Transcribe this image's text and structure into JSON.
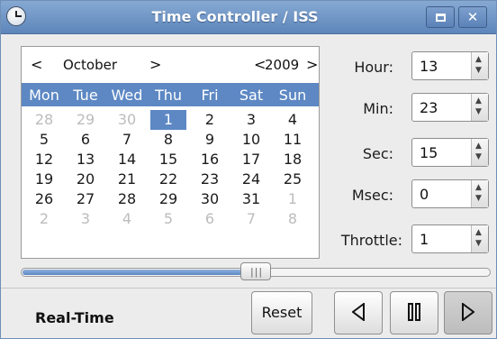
{
  "window": {
    "title": "Time Controller / ISS",
    "icon": "clock-icon"
  },
  "calendar": {
    "prev_month_symbol": "<",
    "month": "October",
    "next_month_symbol": ">",
    "prev_year_symbol": "<",
    "year": "2009",
    "next_year_symbol": ">",
    "weekdays": [
      "Mon",
      "Tue",
      "Wed",
      "Thu",
      "Fri",
      "Sat",
      "Sun"
    ],
    "weeks": [
      [
        "28",
        "29",
        "30",
        "1",
        "2",
        "3",
        "4"
      ],
      [
        "5",
        "6",
        "7",
        "8",
        "9",
        "10",
        "11"
      ],
      [
        "12",
        "13",
        "14",
        "15",
        "16",
        "17",
        "18"
      ],
      [
        "19",
        "20",
        "21",
        "22",
        "23",
        "24",
        "25"
      ],
      [
        "26",
        "27",
        "28",
        "29",
        "30",
        "31",
        "1"
      ],
      [
        "2",
        "3",
        "4",
        "5",
        "6",
        "7",
        "8"
      ]
    ],
    "selected_day": "1"
  },
  "fields": {
    "hour_label": "Hour:",
    "hour_value": "13",
    "min_label": "Min:",
    "min_value": "23",
    "sec_label": "Sec:",
    "sec_value": "15",
    "msec_label": "Msec:",
    "msec_value": "0",
    "throttle_label": "Throttle:",
    "throttle_value": "1"
  },
  "slider": {
    "position_fraction": 0.5
  },
  "bottom": {
    "mode_label": "Real-Time",
    "reset_label": "Reset"
  },
  "colors": {
    "accent": "#5d88c4",
    "titlebar": "#6f93c4"
  }
}
